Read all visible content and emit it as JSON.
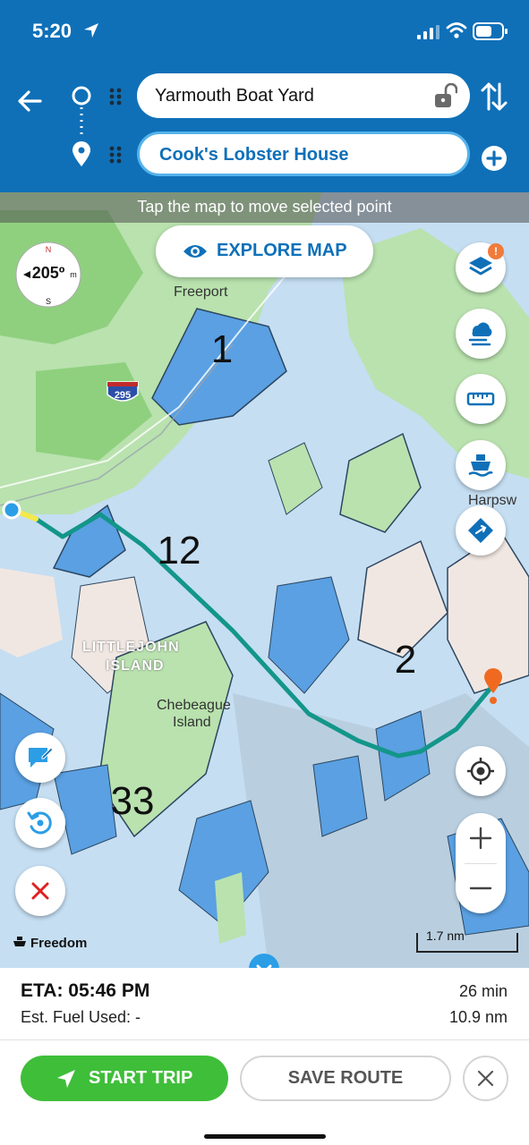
{
  "status": {
    "time": "5:20"
  },
  "route": {
    "from": "Yarmouth Boat Yard",
    "to": "Cook's Lobster House"
  },
  "map": {
    "hint": "Tap the map to move selected point",
    "explore_label": "EXPLORE MAP",
    "compass_heading": "205º",
    "labels": {
      "freeport": "Freeport",
      "harpswell": "Harpsw",
      "littlejohn_1": "LITTLEJOHN",
      "littlejohn_2": "ISLAND",
      "chebeague_1": "Chebeague",
      "chebeague_2": "Island",
      "highway": "295",
      "depth_1": "1",
      "depth_12": "12",
      "depth_2": "2",
      "depth_33": "33"
    },
    "layers_badge": "!",
    "scale_label": "1.7 nm",
    "boat_name": "Freedom"
  },
  "trip": {
    "eta": "ETA: 05:46 PM",
    "fuel": "Est. Fuel Used: -",
    "duration": "26 min",
    "distance": "10.9 nm"
  },
  "actions": {
    "start_label": "START TRIP",
    "save_label": "SAVE ROUTE"
  },
  "colors": {
    "header": "#0f70b8",
    "route_line": "#13968a",
    "start_button": "#3fbe3a",
    "accent": "#2b9ee6"
  }
}
